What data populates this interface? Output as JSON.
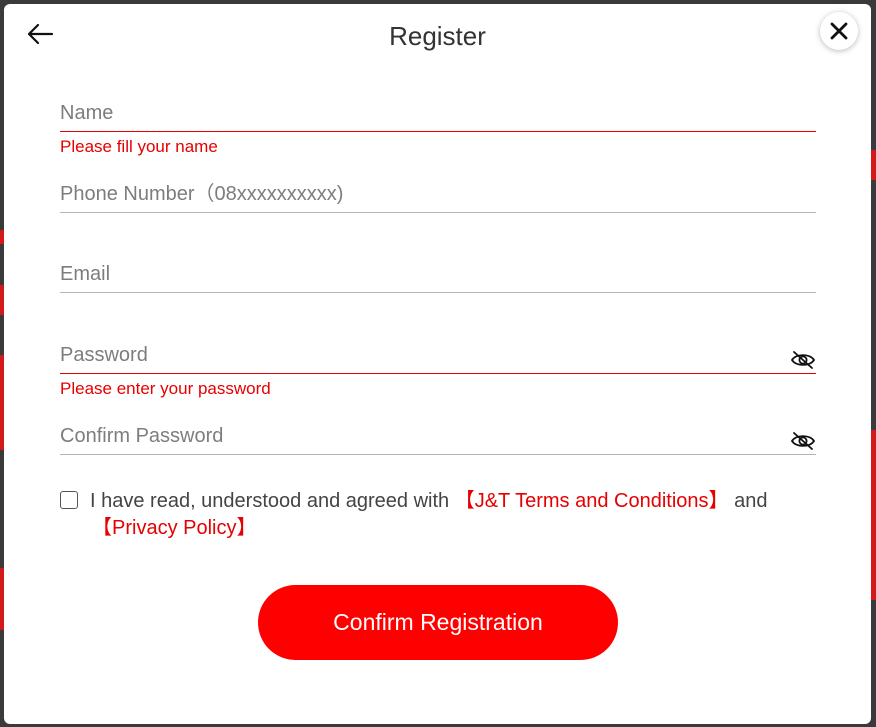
{
  "header": {
    "title": "Register"
  },
  "form": {
    "name": {
      "placeholder": "Name",
      "error": "Please fill your name"
    },
    "phone": {
      "placeholder": "Phone Number（08xxxxxxxxxx)"
    },
    "email": {
      "placeholder": "Email"
    },
    "password": {
      "placeholder": "Password",
      "error": "Please enter your password"
    },
    "confirm_password": {
      "placeholder": "Confirm Password"
    }
  },
  "agreement": {
    "text": "I have read, understood and agreed with",
    "terms_link": "【J&T Terms and Conditions】",
    "and": "and",
    "privacy_link": "【Privacy Policy】"
  },
  "buttons": {
    "confirm_label": "Confirm Registration"
  },
  "icons": {
    "back": "arrow-left-icon",
    "close": "close-icon",
    "visibility": "eye-slash-icon"
  },
  "colors": {
    "accent": "#ff0000",
    "error": "#e60000",
    "text": "#333333"
  }
}
